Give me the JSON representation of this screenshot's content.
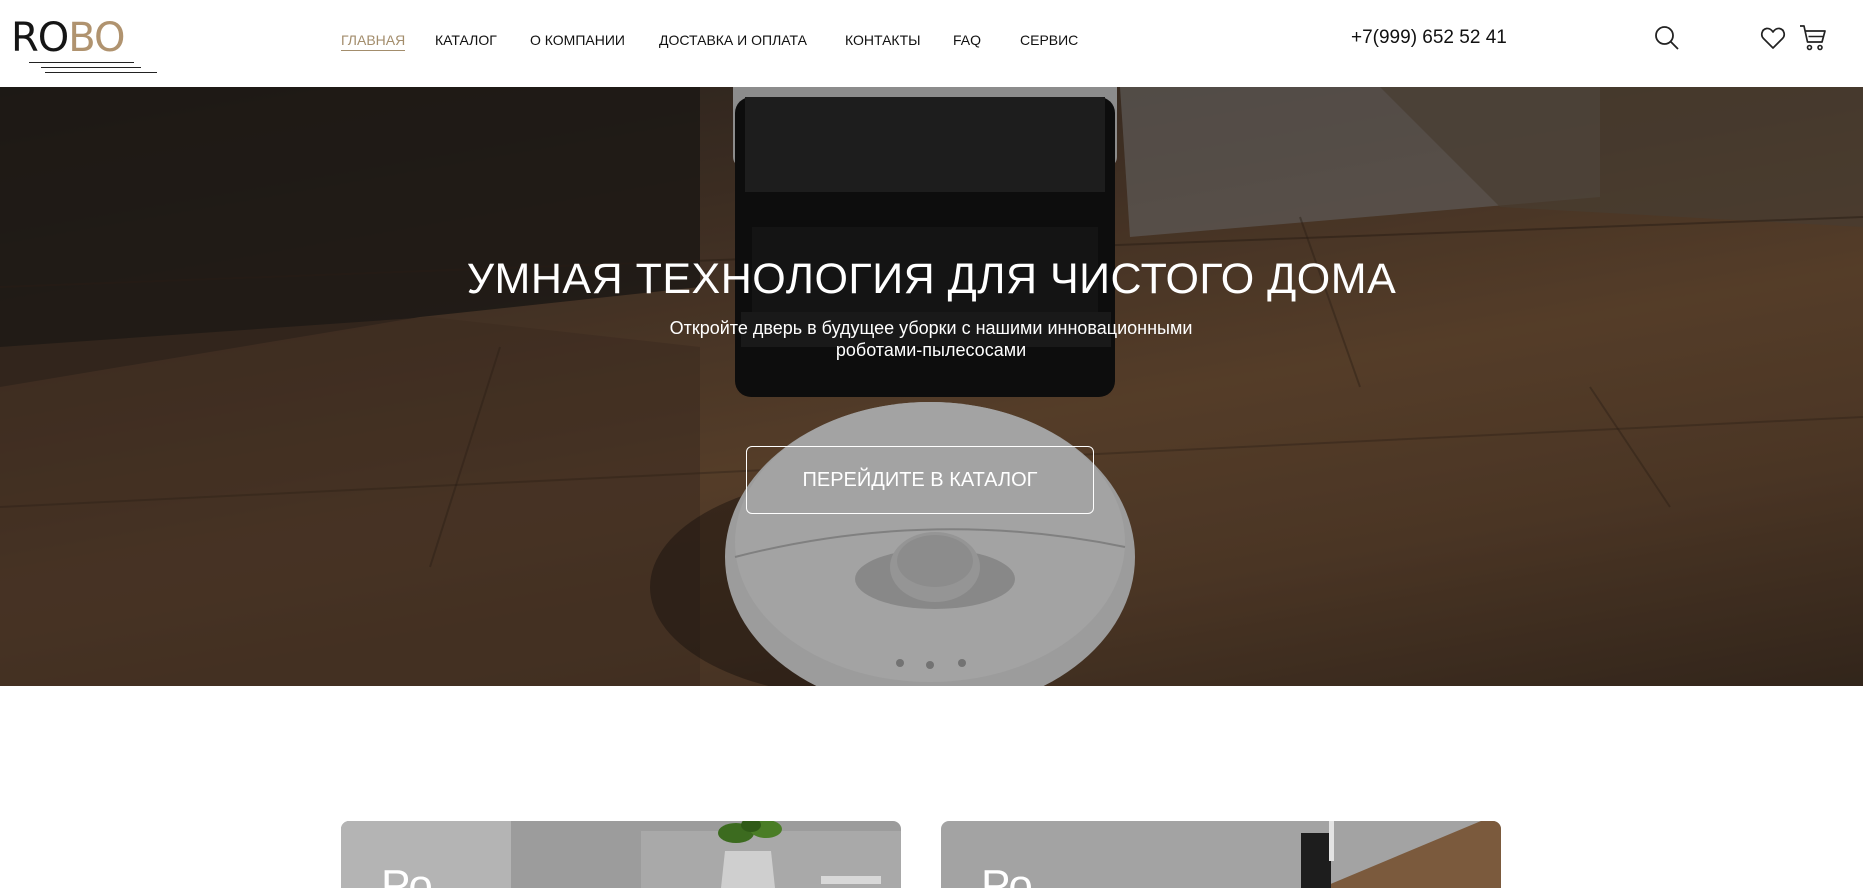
{
  "header": {
    "logo": {
      "part1": "RO",
      "part2": "BO"
    },
    "nav": [
      {
        "label": "ГЛАВНАЯ",
        "active": true
      },
      {
        "label": "КАТАЛОГ"
      },
      {
        "label": "О КОМПАНИИ"
      },
      {
        "label": "ДОСТАВКА И ОПЛАТА"
      },
      {
        "label": "КОНТАКТЫ"
      },
      {
        "label": "FAQ"
      },
      {
        "label": "СЕРВИС"
      }
    ],
    "phone": "+7(999) 652 52 41",
    "icons": [
      "search-icon",
      "heart-icon",
      "cart-icon"
    ]
  },
  "hero": {
    "title": "УМНАЯ ТЕХНОЛОГИЯ ДЛЯ ЧИСТОГО ДОМА",
    "subtitle": "Откройте дверь в будущее уборки с нашими инновационными роботами-пылесосами",
    "cta": "ПЕРЕЙДИТЕ В КАТАЛОГ"
  },
  "cards": [
    {
      "title": "Ро"
    },
    {
      "title": "Ро"
    }
  ],
  "colors": {
    "accent": "#a38d6c",
    "logo_accent": "#b0936f"
  }
}
